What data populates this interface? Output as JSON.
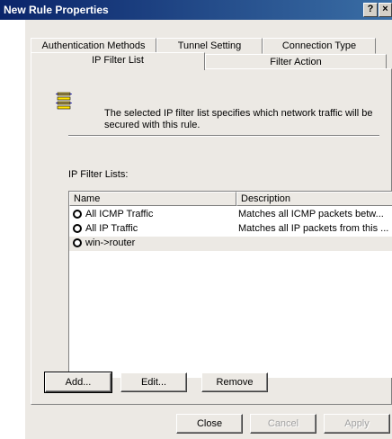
{
  "window": {
    "title": "New Rule Properties",
    "help_label": "?",
    "close_label": "×"
  },
  "tabs": [
    {
      "label": "Authentication Methods"
    },
    {
      "label": "Tunnel Setting"
    },
    {
      "label": "Connection Type"
    },
    {
      "label": "IP Filter List",
      "selected": true
    },
    {
      "label": "Filter Action"
    }
  ],
  "panel": {
    "description": "The selected IP filter list specifies which network traffic will be secured with this rule.",
    "lists_label": "IP Filter Lists:",
    "columns": [
      "Name",
      "Description"
    ],
    "rows": [
      {
        "name": "All ICMP Traffic",
        "description": "Matches all ICMP packets betw..."
      },
      {
        "name": "All IP Traffic",
        "description": "Matches all IP packets from this ..."
      },
      {
        "name": "win->router",
        "description": "",
        "selected": true
      }
    ],
    "buttons": {
      "add": "Add...",
      "edit": "Edit...",
      "remove": "Remove"
    }
  },
  "footer": {
    "close": "Close",
    "cancel": "Cancel",
    "apply": "Apply"
  }
}
